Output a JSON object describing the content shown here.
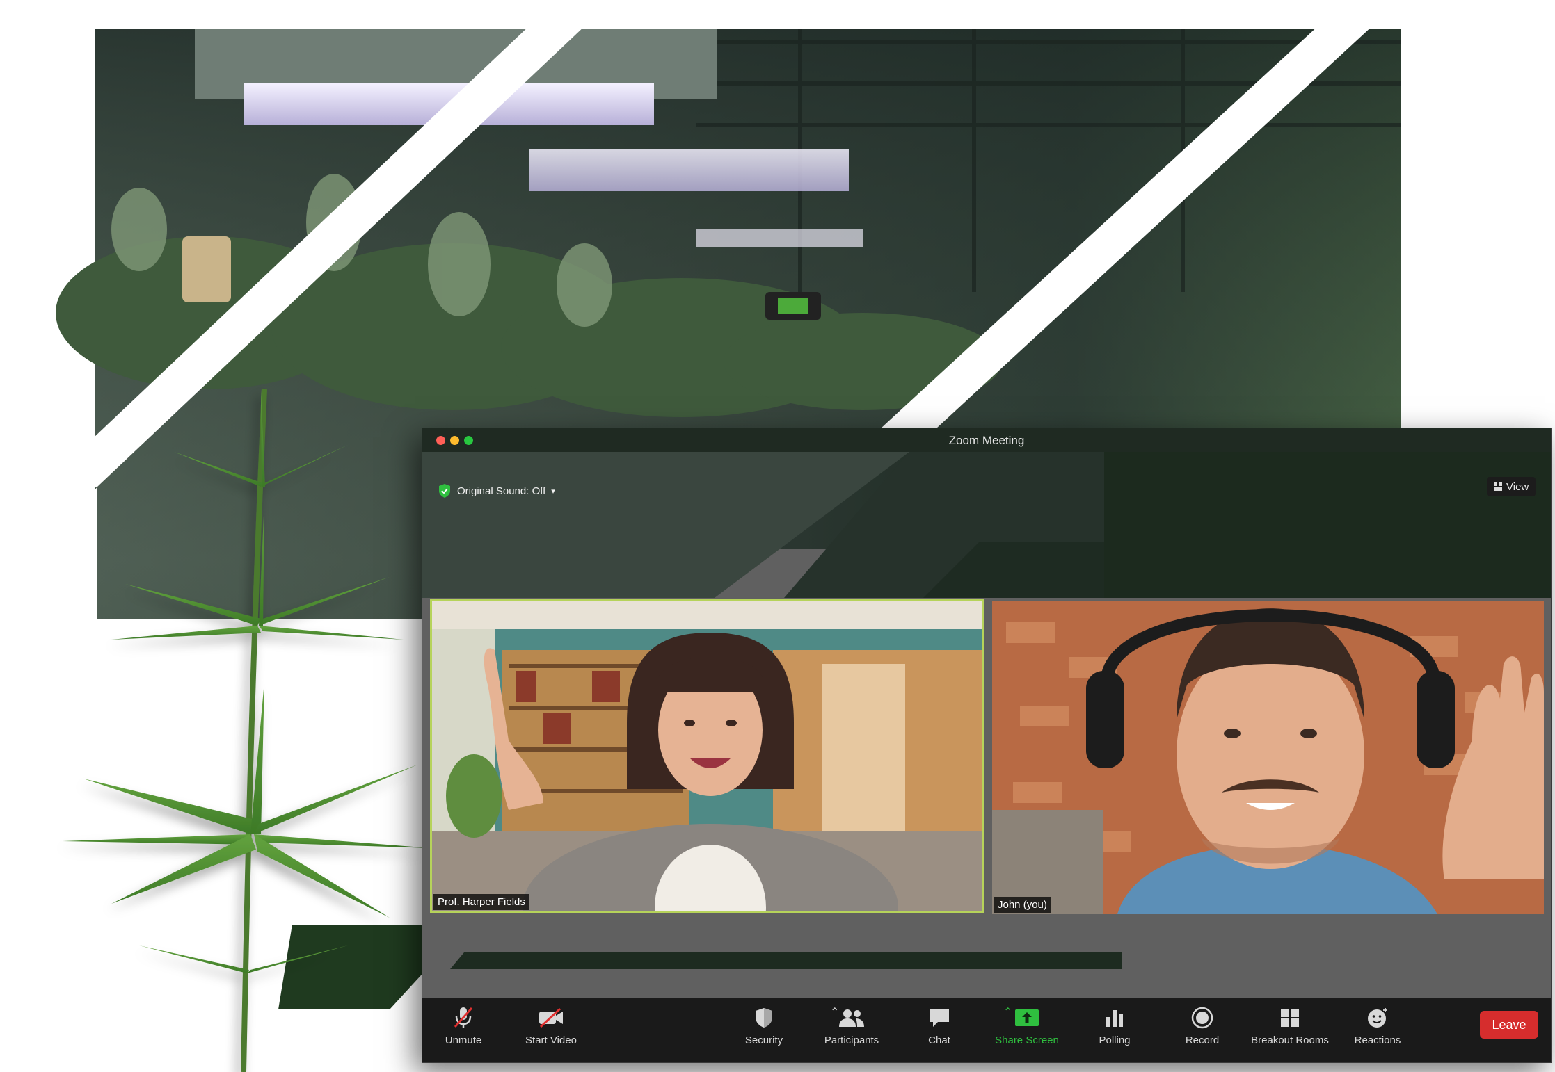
{
  "window": {
    "title": "Zoom Meeting"
  },
  "meeting": {
    "original_sound_label": "Original Sound: Off",
    "view_label": "View"
  },
  "participants": [
    {
      "name": "Prof. Harper Fields",
      "active_speaker": true
    },
    {
      "name": "John (you)",
      "active_speaker": false
    }
  ],
  "toolbar": {
    "unmute": "Unmute",
    "start_video": "Start Video",
    "security": "Security",
    "participants": "Participants",
    "chat": "Chat",
    "share_screen": "Share Screen",
    "polling": "Polling",
    "record": "Record",
    "breakout_rooms": "Breakout Rooms",
    "reactions": "Reactions",
    "leave": "Leave"
  },
  "colors": {
    "active_speaker_border": "#b6d35a",
    "share_screen_green": "#2fbf3f",
    "leave_red": "#d62d2d",
    "muted_slash_red": "#e03030",
    "traffic_red": "#ff5f57",
    "traffic_yellow": "#febc2e",
    "traffic_green": "#28c840"
  }
}
